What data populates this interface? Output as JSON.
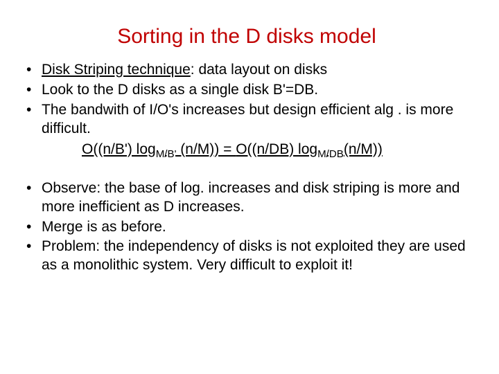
{
  "title": "Sorting in the D disks model",
  "group1": {
    "b1": {
      "prefix": "Disk Striping technique",
      "rest": ": data layout on disks"
    },
    "b2": "Look to the D disks as a single disk B'=DB.",
    "b3": "The bandwith of I/O's increases but design efficient alg . is more difficult."
  },
  "formula": {
    "lhs_a": "O((n/B') log",
    "lhs_sub": "M/B'",
    "lhs_b": " (n/M)) = ",
    "rhs_a": " O((n/DB) log",
    "rhs_sub": "M/DB",
    "rhs_b": "(n/M))"
  },
  "group2": {
    "b4": "Observe: the base of log. increases and disk striping is more and more inefficient as D increases.",
    "b5": "Merge is as before.",
    "b6": "Problem: the independency of disks is not exploited they are used as a monolithic system. Very difficult to exploit it!"
  }
}
